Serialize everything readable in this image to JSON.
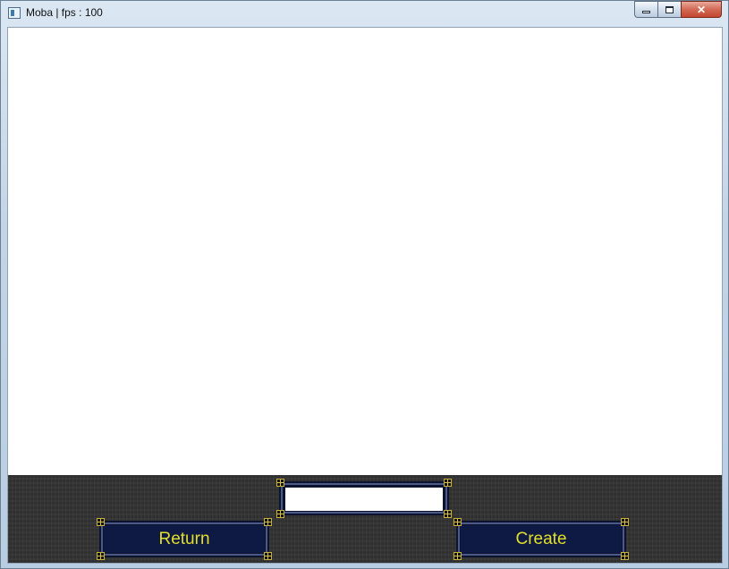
{
  "window": {
    "title": "Moba | fps : 100",
    "minimize_icon": "minimize-icon",
    "maximize_icon": "maximize-icon",
    "close_glyph": "✕"
  },
  "form": {
    "name_input_value": "",
    "name_input_placeholder": "",
    "return_label": "Return",
    "create_label": "Create"
  },
  "colors": {
    "panel_background": "#333333",
    "button_fill": "#0f1a44",
    "button_text": "#e3df2a",
    "frame_corner": "#c9b23a"
  }
}
